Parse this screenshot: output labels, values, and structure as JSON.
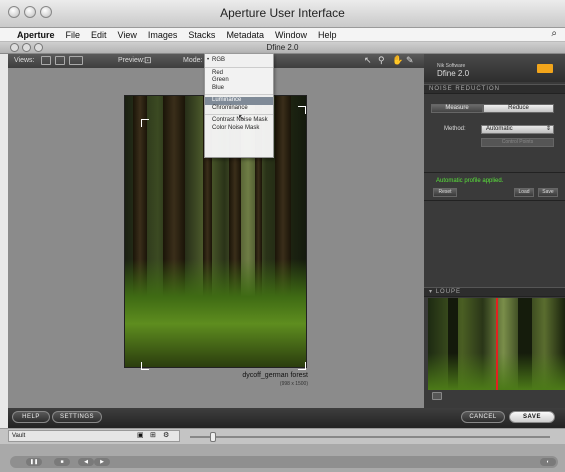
{
  "window": {
    "title": "Aperture User Interface"
  },
  "menubar": {
    "apple": "",
    "items": [
      "Aperture",
      "File",
      "Edit",
      "View",
      "Images",
      "Stacks",
      "Metadata",
      "Window",
      "Help"
    ],
    "search_glyph": "⌕"
  },
  "plugin": {
    "title": "Dfine 2.0"
  },
  "toolbar": {
    "views_label": "Views:",
    "preview_label": "Preview:",
    "preview_icon": "⊡",
    "mode_label": "Mode:"
  },
  "dropdown": {
    "groups": [
      [
        "RGB"
      ],
      [
        "Red",
        "Green",
        "Blue"
      ],
      [
        "Luminance",
        "Chrominance"
      ],
      [
        "Contrast Noise Mask",
        "Color Noise Mask"
      ]
    ],
    "checked": "RGB",
    "highlighted": "Luminance"
  },
  "photo": {
    "caption": "dycoff_german forest",
    "dims": "(998 x 1500)"
  },
  "panel": {
    "brand": "Nik Software",
    "product": "Dfine 2.0",
    "section_noise": "NOISE REDUCTION",
    "measure_label": "Measure",
    "reduce_label": "Reduce",
    "method_label": "Method:",
    "method_value": "Automatic",
    "params_button": "Control Points",
    "status": "Automatic profile applied.",
    "reset_label": "Reset",
    "load_label": "Load",
    "save_label": "Save",
    "section_loupe": "LOUPE",
    "colors": {
      "status_green": "#59e23a",
      "accent_orange": "#f2a51b",
      "loupe_line": "#e32020"
    }
  },
  "bottom": {
    "help_label": "HELP",
    "settings_label": "SETTINGS",
    "cancel_label": "CANCEL",
    "save_label": "SAVE"
  },
  "strip": {
    "vault_label": "Vault"
  }
}
